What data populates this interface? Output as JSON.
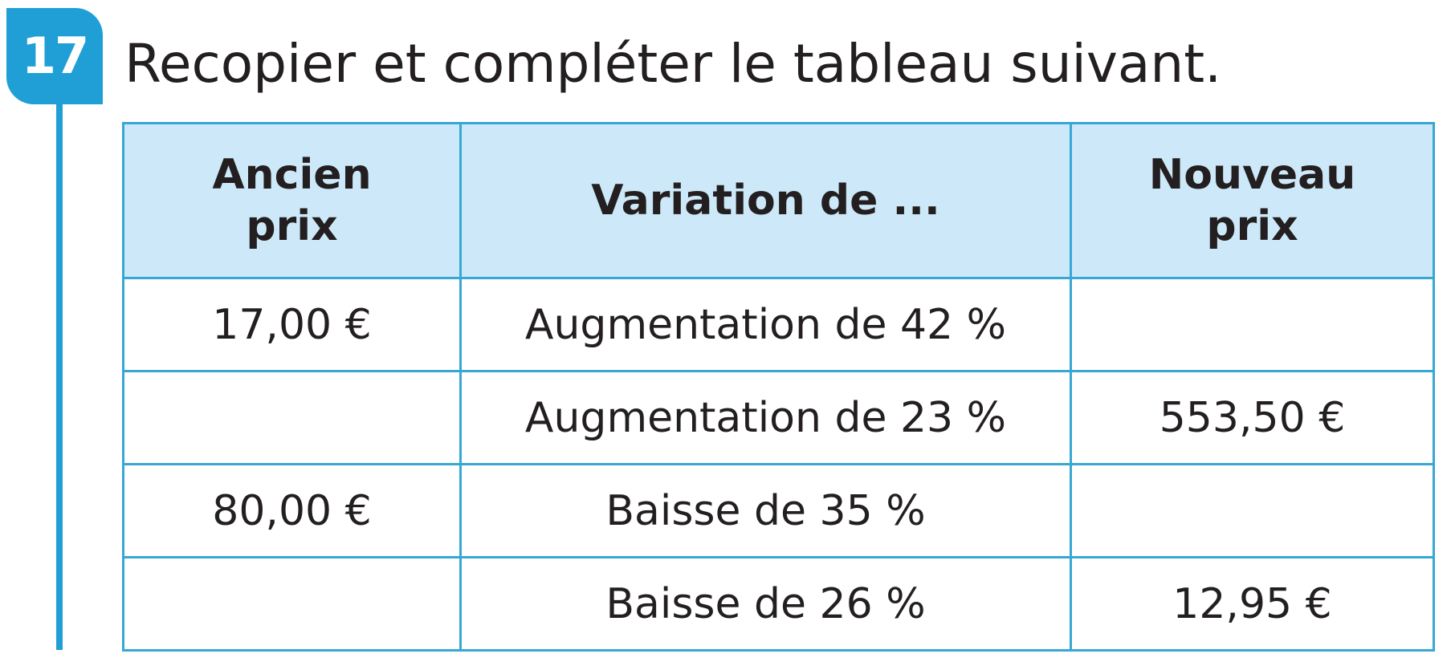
{
  "exercise": {
    "number": "17",
    "instruction": "Recopier et compléter le tableau suivant."
  },
  "table": {
    "headers": {
      "old_price": [
        "Ancien",
        "prix"
      ],
      "variation": "Variation de ...",
      "new_price": [
        "Nouveau",
        "prix"
      ]
    },
    "rows": [
      {
        "old_price": "17,00 €",
        "variation": "Augmentation de 42 %",
        "new_price": ""
      },
      {
        "old_price": "",
        "variation": "Augmentation de 23 %",
        "new_price": "553,50 €"
      },
      {
        "old_price": "80,00 €",
        "variation": "Baisse de 35 %",
        "new_price": ""
      },
      {
        "old_price": "",
        "variation": "Baisse de 26 %",
        "new_price": "12,95 €"
      }
    ]
  },
  "colors": {
    "accent": "#1f9fd6",
    "header_background": "#cde9f9",
    "border": "#37a7d3",
    "text": "#231f20"
  }
}
